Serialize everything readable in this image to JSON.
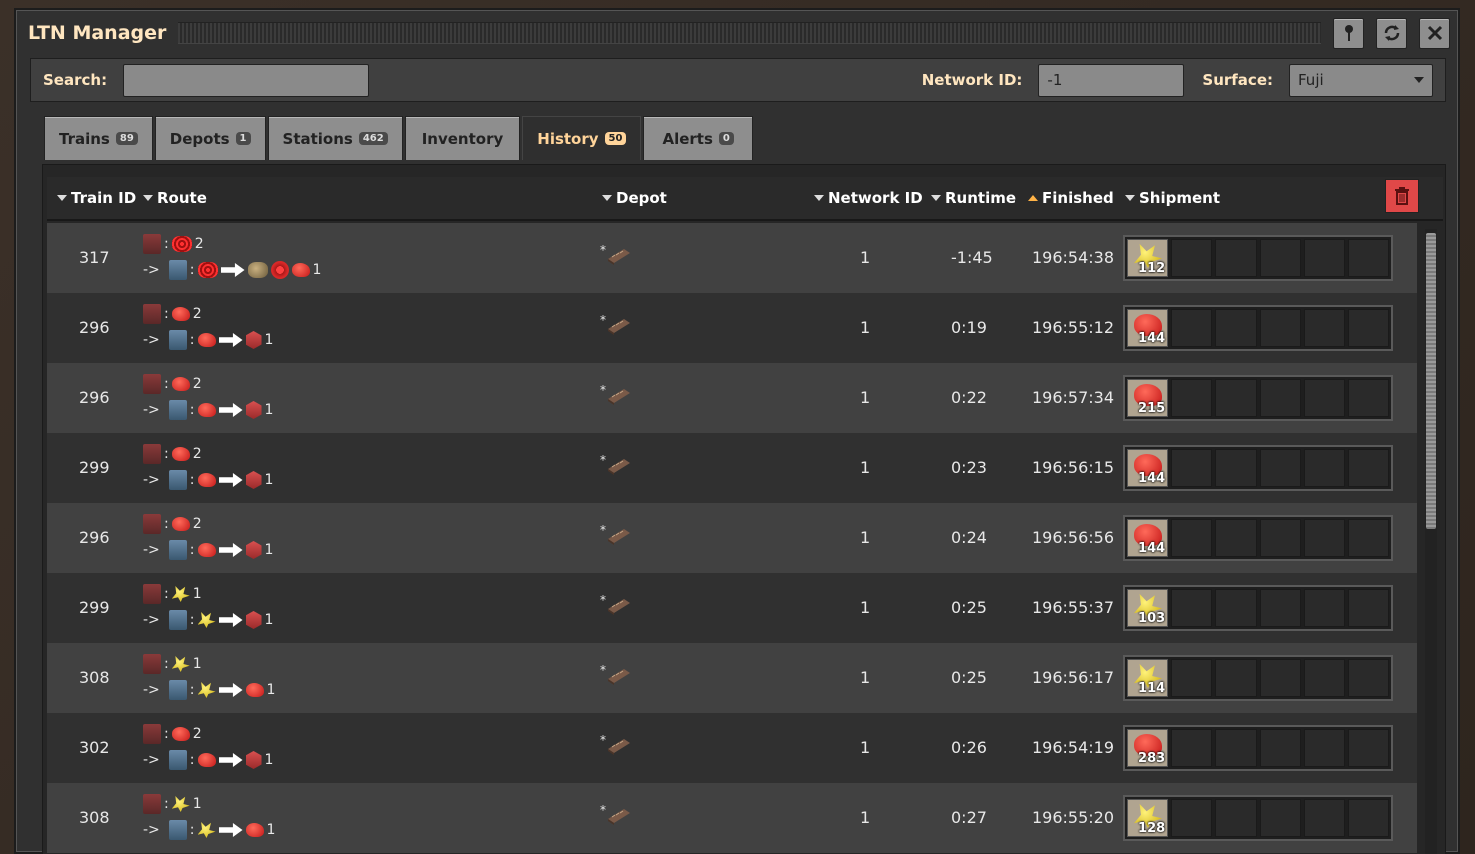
{
  "window": {
    "title": "LTN Manager"
  },
  "titlebar": {
    "pin_icon": "pin-icon",
    "refresh_icon": "refresh-icon",
    "close_icon": "close-icon"
  },
  "search": {
    "label": "Search:",
    "value": ""
  },
  "network": {
    "label": "Network ID:",
    "value": "-1"
  },
  "surface": {
    "label": "Surface:",
    "value": "Fuji"
  },
  "tabs": [
    {
      "label": "Trains",
      "count": "89"
    },
    {
      "label": "Depots",
      "count": "1"
    },
    {
      "label": "Stations",
      "count": "462"
    },
    {
      "label": "Inventory",
      "count": ""
    },
    {
      "label": "History",
      "count": "50"
    },
    {
      "label": "Alerts",
      "count": "0"
    }
  ],
  "active_tab": "History",
  "columns": {
    "train_id": "Train ID",
    "route": "Route",
    "depot": "Depot",
    "network_id": "Network ID",
    "runtime": "Runtime",
    "finished": "Finished",
    "shipment": "Shipment"
  },
  "sort_column": "Finished",
  "rows": [
    {
      "train_id": "317",
      "route_from_count": "2",
      "route_to_count": "1",
      "network_id": "1",
      "runtime": "-1:45",
      "finished": "196:54:38",
      "shipment_count": "112",
      "item": "gold"
    },
    {
      "train_id": "296",
      "route_from_count": "2",
      "route_to_count": "1",
      "network_id": "1",
      "runtime": "0:19",
      "finished": "196:55:12",
      "shipment_count": "144",
      "item": "red"
    },
    {
      "train_id": "296",
      "route_from_count": "2",
      "route_to_count": "1",
      "network_id": "1",
      "runtime": "0:22",
      "finished": "196:57:34",
      "shipment_count": "215",
      "item": "red"
    },
    {
      "train_id": "299",
      "route_from_count": "2",
      "route_to_count": "1",
      "network_id": "1",
      "runtime": "0:23",
      "finished": "196:56:15",
      "shipment_count": "144",
      "item": "red"
    },
    {
      "train_id": "296",
      "route_from_count": "2",
      "route_to_count": "1",
      "network_id": "1",
      "runtime": "0:24",
      "finished": "196:56:56",
      "shipment_count": "144",
      "item": "red"
    },
    {
      "train_id": "299",
      "route_from_count": "1",
      "route_to_count": "1",
      "network_id": "1",
      "runtime": "0:25",
      "finished": "196:55:37",
      "shipment_count": "103",
      "item": "gold"
    },
    {
      "train_id": "308",
      "route_from_count": "1",
      "route_to_count": "1",
      "network_id": "1",
      "runtime": "0:25",
      "finished": "196:56:17",
      "shipment_count": "114",
      "item": "gold"
    },
    {
      "train_id": "302",
      "route_from_count": "2",
      "route_to_count": "1",
      "network_id": "1",
      "runtime": "0:26",
      "finished": "196:54:19",
      "shipment_count": "283",
      "item": "red"
    },
    {
      "train_id": "308",
      "route_from_count": "1",
      "route_to_count": "1",
      "network_id": "1",
      "runtime": "0:27",
      "finished": "196:55:20",
      "shipment_count": "128",
      "item": "gold"
    }
  ],
  "route_prefix": "->",
  "route_sep": ":",
  "depot_marker": "*",
  "colors": {
    "accent": "#ffd49a",
    "danger": "#e04848",
    "panel": "#303030"
  }
}
